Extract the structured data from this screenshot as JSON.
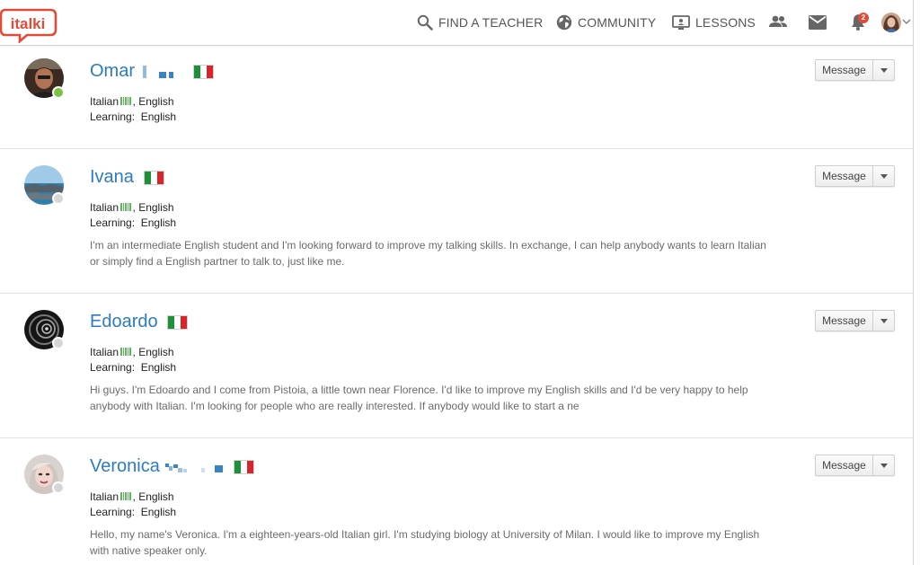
{
  "brand": {
    "logo_text": "italki",
    "logo_color": "#e24b38"
  },
  "nav": {
    "find_teacher": "FIND A TEACHER",
    "community": "COMMUNITY",
    "lessons": "LESSONS",
    "notification_count": "2"
  },
  "icons": [
    "search-icon",
    "globe-icon",
    "lessons-icon",
    "people-icon",
    "mail-icon",
    "bell-icon",
    "chevron-down-icon",
    "caret-down-icon"
  ],
  "colors": {
    "name_link": "#2b7cc2",
    "online": "#7cc242",
    "offline": "#d6d6d6",
    "level_bar": "#5cb85c"
  },
  "profiles": [
    {
      "name": "Omar",
      "status": "online",
      "native_language": "Italian",
      "other_language": ", English",
      "learning_label": "Learning:",
      "learning": "English",
      "bio": "",
      "message_label": "Message"
    },
    {
      "name": "Ivana",
      "status": "offline",
      "native_language": "Italian",
      "other_language": ", English",
      "learning_label": "Learning:",
      "learning": "English",
      "bio": "I'm an intermediate English student and I'm looking forward to improve my talking skills. In exchange, I can help anybody wants to learn Italian or simply find a English partner to talk to, just like me.",
      "message_label": "Message"
    },
    {
      "name": "Edoardo",
      "status": "offline",
      "native_language": "Italian",
      "other_language": ", English",
      "learning_label": "Learning:",
      "learning": "English",
      "bio": "Hi guys. I'm Edoardo and I come from Pistoia, a little town near Florence. I'd like to improve my English skills and I'd be very happy to help anybody with Italian. I'm looking for people who are really interested. If anybody would like to start a ne",
      "message_label": "Message"
    },
    {
      "name": "Veronica",
      "status": "offline",
      "native_language": "Italian",
      "other_language": ", English",
      "learning_label": "Learning:",
      "learning": "English",
      "bio": "Hello, my name's Veronica. I'm a eighteen-years-old Italian girl. I'm studying biology at University of Milan. I would like to improve my English with native speaker only.",
      "message_label": "Message"
    }
  ]
}
